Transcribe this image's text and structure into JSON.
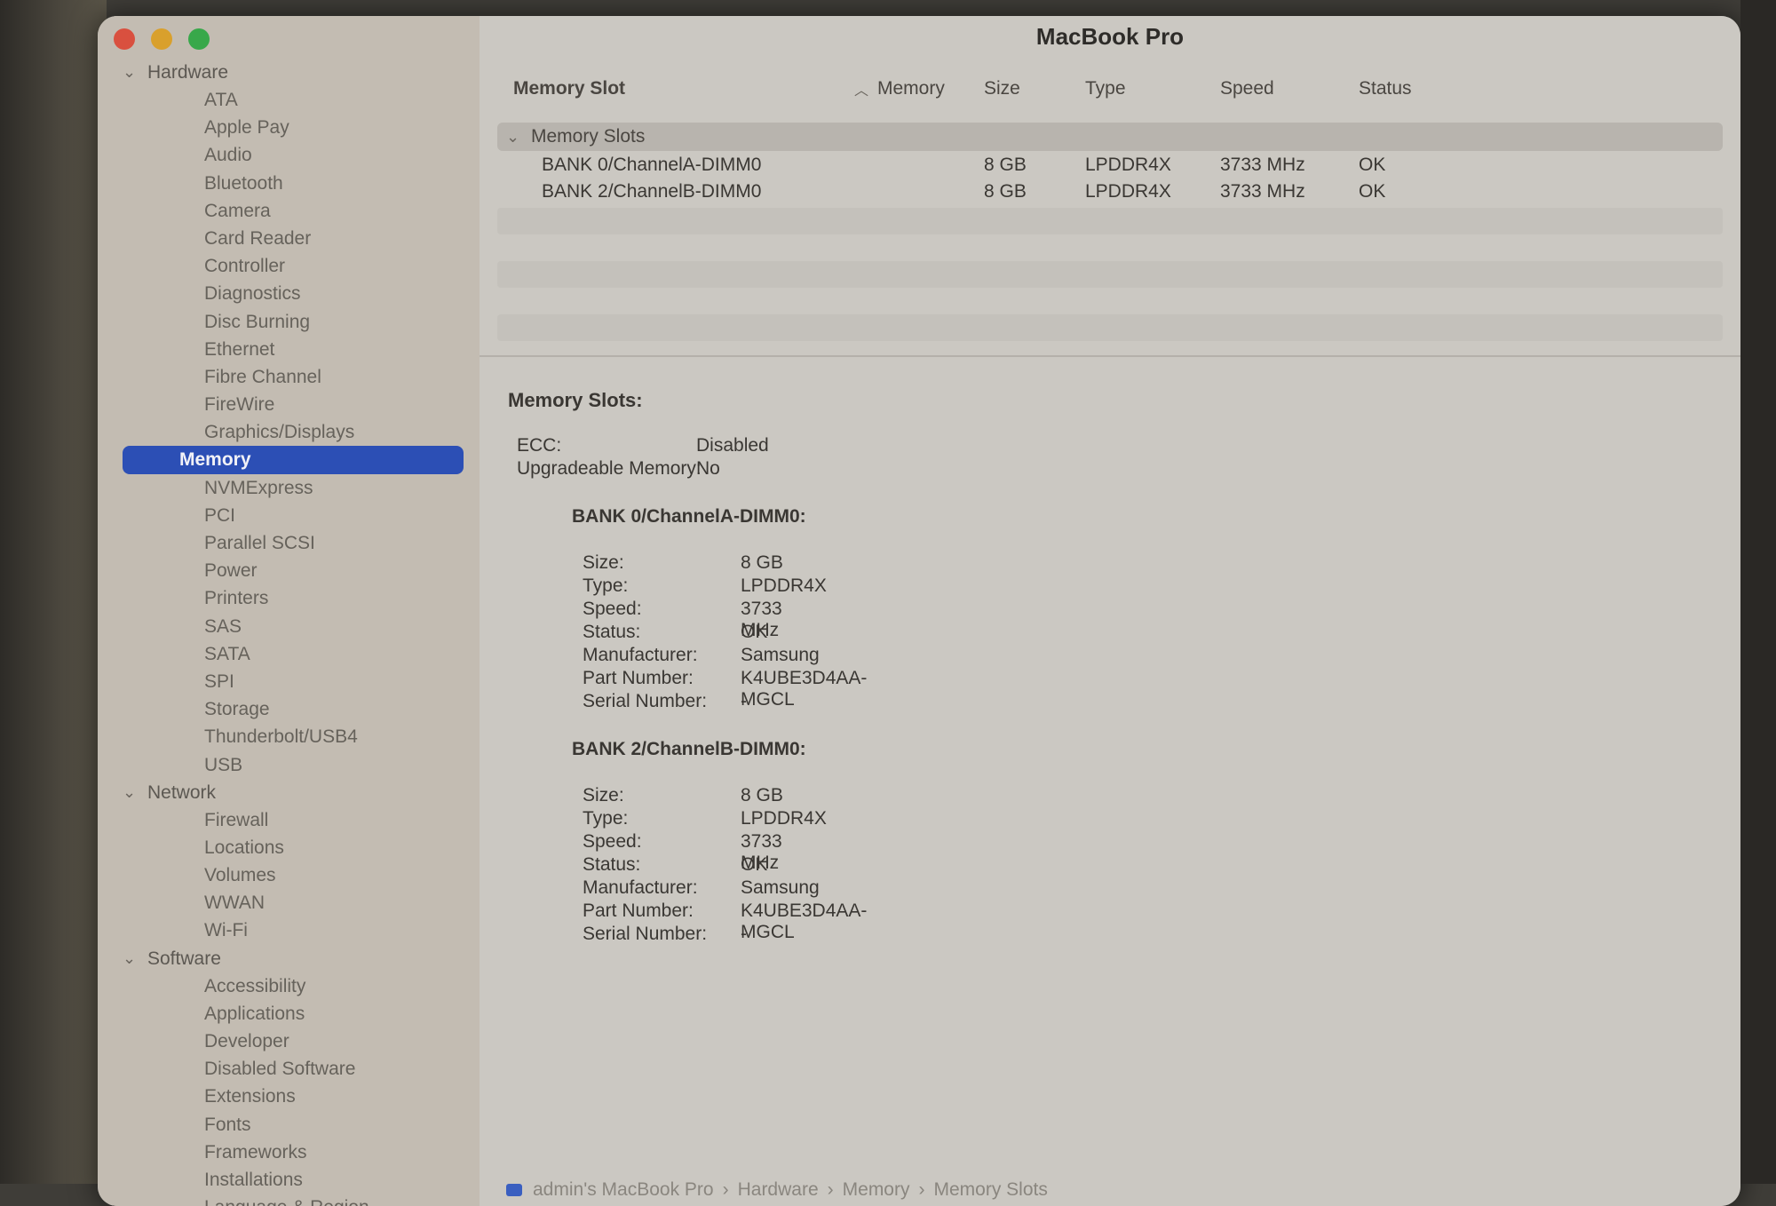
{
  "window": {
    "title": "MacBook Pro"
  },
  "sidebar": {
    "groups": [
      {
        "label": "Hardware",
        "items": [
          "ATA",
          "Apple Pay",
          "Audio",
          "Bluetooth",
          "Camera",
          "Card Reader",
          "Controller",
          "Diagnostics",
          "Disc Burning",
          "Ethernet",
          "Fibre Channel",
          "FireWire",
          "Graphics/Displays",
          "Memory",
          "NVMExpress",
          "PCI",
          "Parallel SCSI",
          "Power",
          "Printers",
          "SAS",
          "SATA",
          "SPI",
          "Storage",
          "Thunderbolt/USB4",
          "USB"
        ]
      },
      {
        "label": "Network",
        "items": [
          "Firewall",
          "Locations",
          "Volumes",
          "WWAN",
          "Wi-Fi"
        ]
      },
      {
        "label": "Software",
        "items": [
          "Accessibility",
          "Applications",
          "Developer",
          "Disabled Software",
          "Extensions",
          "Fonts",
          "Frameworks",
          "Installations",
          "Language & Region"
        ]
      }
    ],
    "selected": "Memory"
  },
  "table": {
    "columns": {
      "slot": "Memory Slot",
      "memory": "Memory",
      "size": "Size",
      "type": "Type",
      "speed": "Speed",
      "status": "Status"
    },
    "group_label": "Memory Slots",
    "rows": [
      {
        "slot": "BANK 0/ChannelA-DIMM0",
        "size": "8 GB",
        "type": "LPDDR4X",
        "speed": "3733 MHz",
        "status": "OK"
      },
      {
        "slot": "BANK 2/ChannelB-DIMM0",
        "size": "8 GB",
        "type": "LPDDR4X",
        "speed": "3733 MHz",
        "status": "OK"
      }
    ]
  },
  "details": {
    "heading": "Memory Slots:",
    "ecc_label": "ECC:",
    "ecc_value": "Disabled",
    "upgradeable_label": "Upgradeable Memory:",
    "upgradeable_value": "No",
    "labels": {
      "size": "Size:",
      "type": "Type:",
      "speed": "Speed:",
      "status": "Status:",
      "manufacturer": "Manufacturer:",
      "part": "Part Number:",
      "serial": "Serial Number:"
    },
    "banks": [
      {
        "title": "BANK 0/ChannelA-DIMM0:",
        "size": "8 GB",
        "type": "LPDDR4X",
        "speed": "3733 MHz",
        "status": "OK",
        "manufacturer": "Samsung",
        "part": "K4UBE3D4AA-MGCL",
        "serial": "-"
      },
      {
        "title": "BANK 2/ChannelB-DIMM0:",
        "size": "8 GB",
        "type": "LPDDR4X",
        "speed": "3733 MHz",
        "status": "OK",
        "manufacturer": "Samsung",
        "part": "K4UBE3D4AA-MGCL",
        "serial": "-"
      }
    ]
  },
  "breadcrumb": {
    "items": [
      "admin's MacBook Pro",
      "Hardware",
      "Memory",
      "Memory Slots"
    ],
    "separator": "›"
  }
}
